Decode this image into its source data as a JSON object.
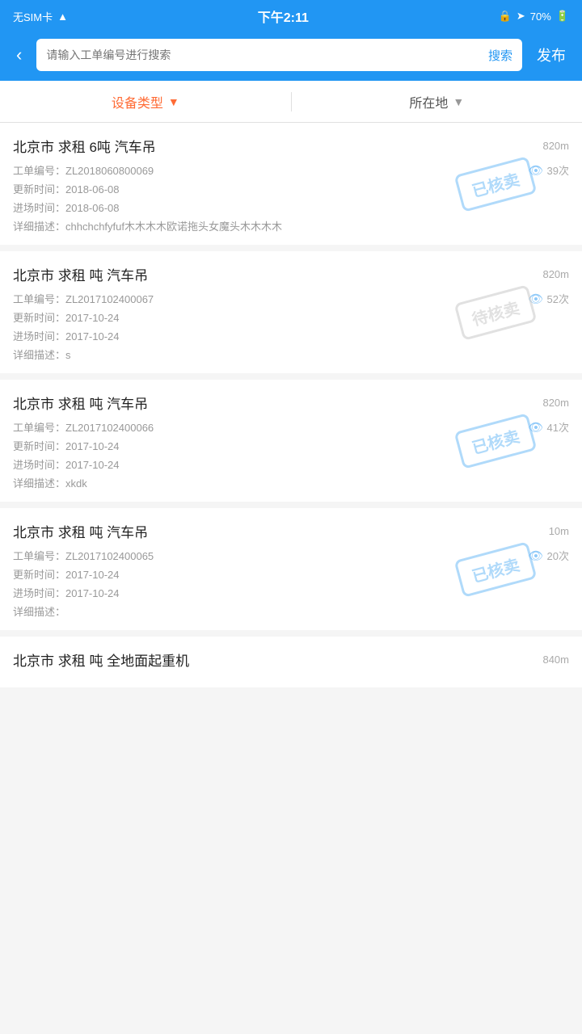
{
  "statusBar": {
    "carrier": "无SIM卡",
    "time": "下午2:11",
    "battery": "70%"
  },
  "header": {
    "backLabel": "‹",
    "searchPlaceholder": "请输入工单编号进行搜索",
    "searchBtnLabel": "搜索",
    "publishLabel": "发布"
  },
  "filters": {
    "deviceType": "设备类型",
    "location": "所在地"
  },
  "items": [
    {
      "title": "北京市 求租 6吨 汽车吊",
      "distance": "820m",
      "orderNo": "工单编号：ZL2018060800069",
      "views": "39次",
      "updateTime": "更新时间：2018-06-08",
      "entryTime": "进场时间：2018-06-08",
      "description": "详细描述：chhchchfyfuf木木木木欧诺拖头女魔头木木木木",
      "stamp": "已核卖",
      "stampType": "sold"
    },
    {
      "title": "北京市 求租 吨 汽车吊",
      "distance": "820m",
      "orderNo": "工单编号：ZL2017102400067",
      "views": "52次",
      "updateTime": "更新时间：2017-10-24",
      "entryTime": "进场时间：2017-10-24",
      "description": "详细描述：s",
      "stamp": "待核卖",
      "stampType": "pending"
    },
    {
      "title": "北京市 求租 吨 汽车吊",
      "distance": "820m",
      "orderNo": "工单编号：ZL2017102400066",
      "views": "41次",
      "updateTime": "更新时间：2017-10-24",
      "entryTime": "进场时间：2017-10-24",
      "description": "详细描述：xkdk",
      "stamp": "已核卖",
      "stampType": "sold"
    },
    {
      "title": "北京市 求租 吨 汽车吊",
      "distance": "10m",
      "orderNo": "工单编号：ZL2017102400065",
      "views": "20次",
      "updateTime": "更新时间：2017-10-24",
      "entryTime": "进场时间：2017-10-24",
      "description": "详细描述：",
      "stamp": "已核卖",
      "stampType": "sold"
    }
  ],
  "lastItem": {
    "title": "北京市 求租 吨 全地面起重机",
    "distance": "840m"
  }
}
